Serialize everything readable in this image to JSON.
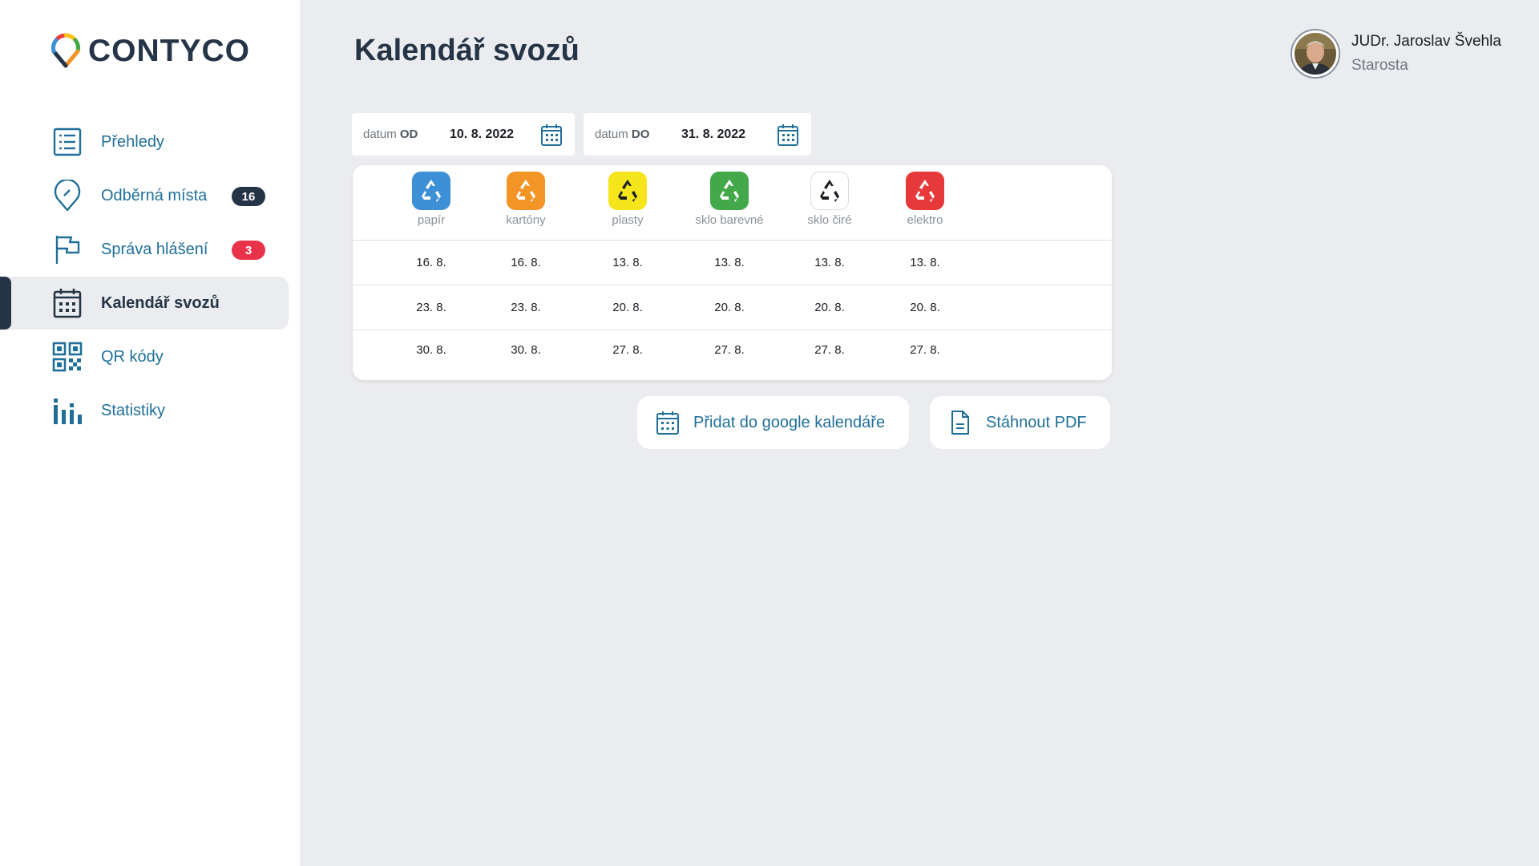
{
  "app": {
    "brand": "CONTYCO"
  },
  "sidebar": {
    "items": [
      {
        "label": "Přehledy",
        "icon": "list-icon",
        "badge": null
      },
      {
        "label": "Odběrná místa",
        "icon": "map-pin-icon",
        "badge": "16"
      },
      {
        "label": "Správa hlášení",
        "icon": "flag-icon",
        "badge": "3"
      },
      {
        "label": "Kalendář svozů",
        "icon": "calendar-icon",
        "badge": null,
        "active": true
      },
      {
        "label": "QR kódy",
        "icon": "qr-code-icon",
        "badge": null
      },
      {
        "label": "Statistiky",
        "icon": "bar-chart-icon",
        "badge": null
      }
    ]
  },
  "header": {
    "title": "Kalendář svozů",
    "user": {
      "name": "JUDr. Jaroslav Švehla",
      "role": "Starosta"
    }
  },
  "filters": {
    "from": {
      "label_prefix": "datum ",
      "label_bold": "OD",
      "value": "10. 8. 2022"
    },
    "to": {
      "label_prefix": "datum ",
      "label_bold": "DO",
      "value": "31. 8. 2022"
    }
  },
  "schedule": {
    "categories": [
      {
        "label": "papír",
        "color": "#3d8fd6",
        "icon": "recycle-icon"
      },
      {
        "label": "kartóny",
        "color": "#f39426",
        "icon": "recycle-icon"
      },
      {
        "label": "plasty",
        "color": "#f6e51b",
        "icon": "recycle-icon"
      },
      {
        "label": "sklo barevné",
        "color": "#43a849",
        "icon": "recycle-icon"
      },
      {
        "label": "sklo čiré",
        "color": "#ffffff",
        "icon": "recycle-icon"
      },
      {
        "label": "elektro",
        "color": "#e8393a",
        "icon": "recycle-icon"
      }
    ],
    "rows": [
      [
        "16. 8.",
        "16. 8.",
        "13. 8.",
        "13. 8.",
        "13. 8.",
        "13. 8."
      ],
      [
        "23. 8.",
        "23. 8.",
        "20. 8.",
        "20. 8.",
        "20. 8.",
        "20. 8."
      ],
      [
        "30. 8.",
        "30. 8.",
        "27. 8.",
        "27. 8.",
        "27. 8.",
        "27. 8."
      ]
    ]
  },
  "actions": {
    "google": "Přidat do google kalendáře",
    "pdf": "Stáhnout PDF"
  }
}
